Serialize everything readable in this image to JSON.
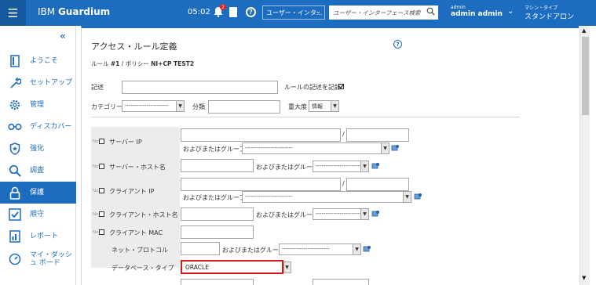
{
  "header": {
    "brand_prefix": "IBM ",
    "brand_name": "Guardium",
    "time": "05:02",
    "notif_count": "2",
    "help_glyph": "?",
    "interface_select": "ユーザー・インタ...",
    "search_placeholder": "ユーザー・インターフェース検索",
    "user_small": "admin",
    "user_name": "admin admin",
    "mode_small": "マシン・タイプ",
    "mode_value": "スタンドアロン"
  },
  "sidebar": {
    "items": [
      {
        "label": "ようこそ",
        "icon": "welcome-icon"
      },
      {
        "label": "セットアップ",
        "icon": "wrench-icon"
      },
      {
        "label": "管理",
        "icon": "gear-icon"
      },
      {
        "label": "ディスカバー",
        "icon": "glasses-icon"
      },
      {
        "label": "強化",
        "icon": "shield-icon"
      },
      {
        "label": "調査",
        "icon": "search-icon"
      },
      {
        "label": "保護",
        "icon": "lock-icon"
      },
      {
        "label": "順守",
        "icon": "checkbox-icon"
      },
      {
        "label": "レポート",
        "icon": "report-icon"
      },
      {
        "label": "マイ・ダッシュ ボード",
        "icon": "dashboard-icon"
      }
    ],
    "active_index": 6
  },
  "panel": {
    "title": "アクセス・ルール定義",
    "rule_prefix": "ルール ",
    "rule_num": "#1",
    "rule_mid": " / ポリシー ",
    "policy_name": "NI+CP TEST2",
    "description_label": "記述",
    "log_description_label": "ルールの記述を記録",
    "category_label": "カテゴリー",
    "category_value": "----------------------",
    "classification_label": "分類",
    "severity_label": "重大度",
    "severity_value": "情報",
    "not_label": "Not",
    "slash": "/",
    "and_group": "およびまたはグループ",
    "group_default": "------------------------",
    "server_ip": "サーバー IP",
    "server_host": "サーバー・ホスト名",
    "client_ip": "クライアント IP",
    "client_host": "クライアント・ホスト名",
    "client_mac": "クライアント MAC",
    "net_protocol": "ネット・プロトコル",
    "db_type": "データベース・タイプ",
    "db_type_value": "ORACLE"
  },
  "colors": {
    "brand": "#1c6dbf",
    "highlight": "#d41c1c"
  }
}
